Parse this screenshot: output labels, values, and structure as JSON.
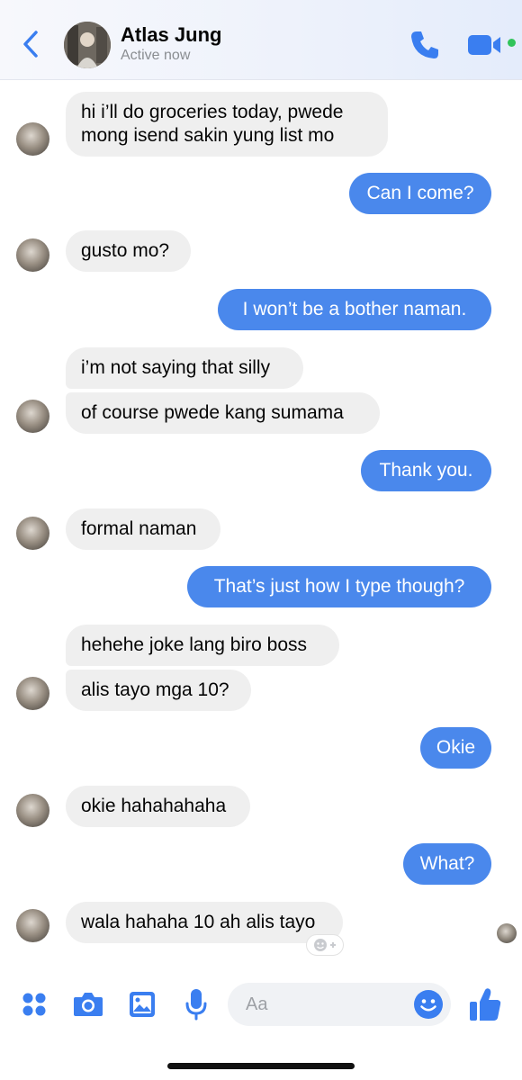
{
  "header": {
    "back_icon": "chevron-left-icon",
    "contact_name": "Atlas Jung",
    "status": "Active now",
    "call_icon": "phone-icon",
    "video_icon": "video-camera-icon",
    "online_color": "#31c45a"
  },
  "colors": {
    "accent": "#4a88ec",
    "incoming_bubble": "#efefef"
  },
  "messages": [
    {
      "direction": "in",
      "text": "hi i’ll do groceries today, pwede\nmong isend sakin yung list mo"
    },
    {
      "direction": "out",
      "text": "Can I come?"
    },
    {
      "direction": "in",
      "text": "gusto mo?"
    },
    {
      "direction": "out",
      "text": "I won’t be a bother naman."
    },
    {
      "direction": "in",
      "text": "i’m not saying that silly"
    },
    {
      "direction": "in",
      "text": "of course pwede kang sumama"
    },
    {
      "direction": "out",
      "text": "Thank you."
    },
    {
      "direction": "in",
      "text": "formal naman"
    },
    {
      "direction": "out",
      "text": "That’s just how I type though?"
    },
    {
      "direction": "in",
      "text": "hehehe joke lang biro boss"
    },
    {
      "direction": "in",
      "text": "alis tayo mga 10?"
    },
    {
      "direction": "out",
      "text": "Okie"
    },
    {
      "direction": "in",
      "text": "okie hahahahaha"
    },
    {
      "direction": "out",
      "text": "What?"
    },
    {
      "direction": "in",
      "text": "wala hahaha 10 ah alis tayo"
    }
  ],
  "composer": {
    "placeholder": "Aa",
    "tools": [
      "menu-grid-icon",
      "camera-icon",
      "photo-gallery-icon",
      "microphone-icon"
    ],
    "emoji_icon": "smiley-icon",
    "like_icon": "thumbs-up-icon"
  }
}
